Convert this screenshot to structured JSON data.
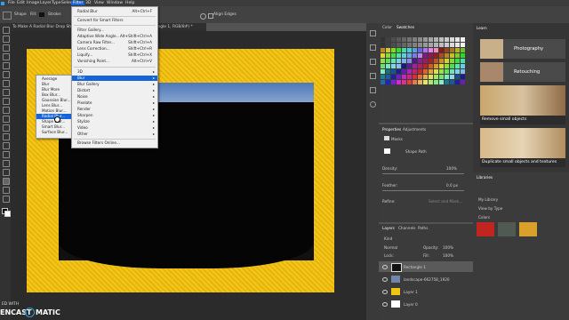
{
  "menubar": {
    "items": [
      "File",
      "Edit",
      "Image",
      "Layer",
      "Type",
      "Select",
      "Filter",
      "3D",
      "View",
      "Window",
      "Help"
    ]
  },
  "options": {
    "shape_label": "Shape",
    "fill_label": "Fill:",
    "stroke_label": "Stroke:",
    "align_edges": "Align Edges"
  },
  "doc_tab": {
    "title": "To Make A Radial Blur Drop Shadow Effect In Photoshop.psd @ 50% (Rectangle 1, RGB/8#) *"
  },
  "filter_menu": {
    "items": [
      {
        "label": "Radial Blur",
        "shortcut": "Alt+Ctrl+F"
      },
      {
        "label": "Convert for Smart Filters",
        "shortcut": ""
      },
      {
        "label": "Filter Gallery...",
        "shortcut": ""
      },
      {
        "label": "Adaptive Wide Angle...",
        "shortcut": "Alt+Shift+Ctrl+A"
      },
      {
        "label": "Camera Raw Filter...",
        "shortcut": "Shift+Ctrl+A"
      },
      {
        "label": "Lens Correction...",
        "shortcut": "Shift+Ctrl+R"
      },
      {
        "label": "Liquify...",
        "shortcut": "Shift+Ctrl+X"
      },
      {
        "label": "Vanishing Point...",
        "shortcut": "Alt+Ctrl+V"
      },
      {
        "label": "3D",
        "shortcut": ""
      },
      {
        "label": "Blur",
        "shortcut": ""
      },
      {
        "label": "Blur Gallery",
        "shortcut": ""
      },
      {
        "label": "Distort",
        "shortcut": ""
      },
      {
        "label": "Noise",
        "shortcut": ""
      },
      {
        "label": "Pixelate",
        "shortcut": ""
      },
      {
        "label": "Render",
        "shortcut": ""
      },
      {
        "label": "Sharpen",
        "shortcut": ""
      },
      {
        "label": "Stylize",
        "shortcut": ""
      },
      {
        "label": "Video",
        "shortcut": ""
      },
      {
        "label": "Other",
        "shortcut": ""
      },
      {
        "label": "Browse Filters Online...",
        "shortcut": ""
      }
    ]
  },
  "blur_submenu": {
    "items": [
      "Average",
      "Blur",
      "Blur More",
      "Box Blur...",
      "Gaussian Blur...",
      "Lens Blur...",
      "Motion Blur...",
      "Radial Blur...",
      "Shape Blur...",
      "Smart Blur...",
      "Surface Blur..."
    ],
    "selected": "Radial Blur..."
  },
  "color_panel": {
    "tabs": [
      "Color",
      "Swatches"
    ]
  },
  "properties_panel": {
    "tabs": [
      "Properties",
      "Adjustments"
    ],
    "masks_label": "Masks",
    "shape_path_label": "Shape Path",
    "density_label": "Density:",
    "density_value": "100%",
    "feather_label": "Feather:",
    "feather_value": "0.0 px",
    "refine_label": "Refine:",
    "select_label": "Select and Mask..."
  },
  "layers_panel": {
    "tabs": [
      "Layers",
      "Channels",
      "Paths"
    ],
    "kind_label": "Kind",
    "blend_mode": "Normal",
    "opacity_label": "Opacity:",
    "opacity_value": "100%",
    "lock_label": "Lock:",
    "fill_label": "Fill:",
    "fill_value": "100%",
    "layers": [
      {
        "name": "Rectangle 1",
        "selected": true
      },
      {
        "name": "landscape-662758_1920",
        "selected": false
      },
      {
        "name": "Layer 1",
        "selected": false
      },
      {
        "name": "Layer 0",
        "selected": false
      }
    ]
  },
  "learn_panel": {
    "tabs": [
      "Learn"
    ],
    "cards": [
      {
        "title": "Photography"
      },
      {
        "title": "Retouching"
      },
      {
        "title": "Remove small objects"
      },
      {
        "title": "Duplicate small objects and textures"
      }
    ]
  },
  "libraries_panel": {
    "tabs": [
      "Libraries"
    ],
    "library_name": "My Library",
    "view_label": "View by Type",
    "colors_label": "Colors"
  },
  "colors": {
    "accent": "#1565d8",
    "yellow": "#f0c414",
    "lib1": "#c0251f",
    "lib2": "#505a52",
    "lib3": "#d9a12a"
  },
  "watermark": {
    "line1": "ED WITH",
    "brand_left": "ENCAST",
    "brand_right": "MATIC"
  }
}
